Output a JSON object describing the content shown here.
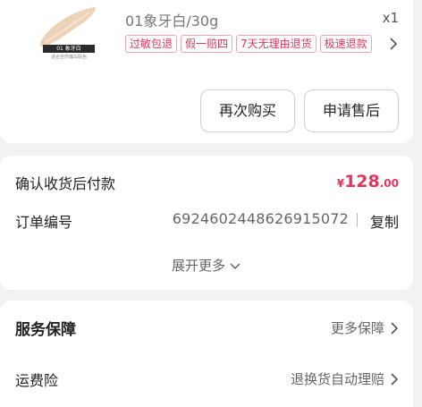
{
  "product": {
    "thumb_label": "01 象牙白",
    "thumb_sub": "适合自然偏白肤色",
    "variant": "01象牙白/30g",
    "quantity": "x1",
    "tags": [
      "过敏包退",
      "假一赔四",
      "7天无理由退货",
      "极速退款"
    ],
    "rebuy_label": "再次购买",
    "aftersale_label": "申请售后"
  },
  "payment": {
    "status_label": "确认收货后付款",
    "price_currency": "¥",
    "price_int": "128",
    "price_dec": ".00",
    "order_label": "订单编号",
    "order_no": "6924602448626915072",
    "copy_label": "复制",
    "expand_label": "展开更多"
  },
  "service": {
    "title": "服务保障",
    "more_label": "更多保障",
    "freight_label": "运费险",
    "freight_value": "退换货自动理赔"
  },
  "colors": {
    "accent": "#e3345e",
    "tag_border": "#f4a3b6",
    "background": "#f2f2f2"
  }
}
